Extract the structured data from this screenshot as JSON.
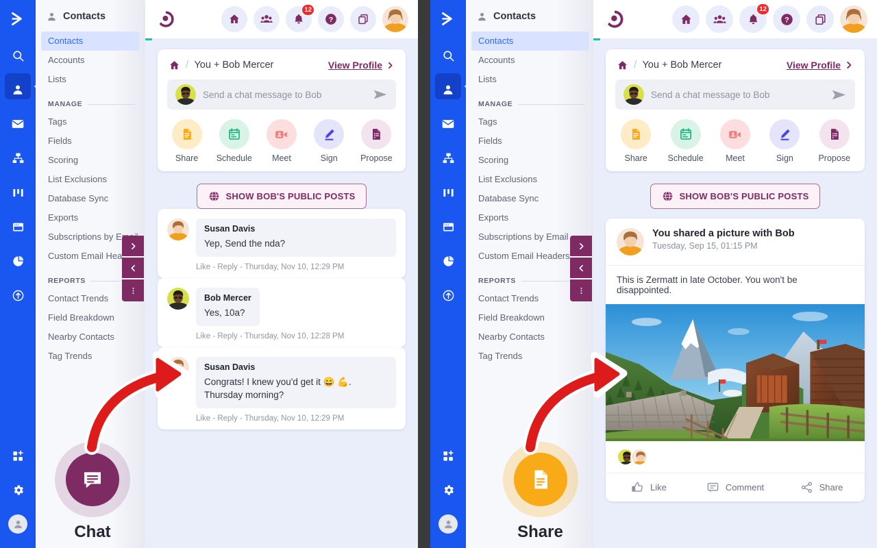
{
  "colors": {
    "rail": "#1a56f0",
    "accent_purple": "#7e2a63",
    "accent_blue": "#2f6bf5",
    "badge_red": "#f0282d",
    "share_yellow": "#f9ab17",
    "chat_purple": "#7e2a63",
    "arrow_red": "#e01b1b"
  },
  "rail": {
    "logo_icon": "chevron-right-logo-icon",
    "items": [
      {
        "icon": "search-icon",
        "name": "search"
      },
      {
        "icon": "person-icon",
        "name": "contacts",
        "active": true
      },
      {
        "icon": "envelope-icon",
        "name": "email"
      },
      {
        "icon": "org-chart-icon",
        "name": "automations"
      },
      {
        "icon": "columns-icon",
        "name": "pipelines"
      },
      {
        "icon": "window-icon",
        "name": "pages"
      },
      {
        "icon": "pie-chart-icon",
        "name": "reports"
      },
      {
        "icon": "arrow-up-circle-icon",
        "name": "upgrade"
      }
    ],
    "bottom": [
      {
        "icon": "apps-add-icon",
        "name": "apps"
      },
      {
        "icon": "gear-icon",
        "name": "settings"
      },
      {
        "icon": "avatar-icon",
        "name": "account"
      }
    ]
  },
  "nav": {
    "title": "Contacts",
    "title_icon": "person-icon",
    "items": [
      {
        "label": "Contacts",
        "selected": true
      },
      {
        "label": "Accounts",
        "selected": false
      },
      {
        "label": "Lists",
        "selected": false
      }
    ],
    "groups": [
      {
        "label": "MANAGE",
        "items": [
          {
            "label": "Tags"
          },
          {
            "label": "Fields"
          },
          {
            "label": "Scoring"
          },
          {
            "label": "List Exclusions"
          },
          {
            "label": "Database Sync"
          },
          {
            "label": "Exports"
          },
          {
            "label": "Subscriptions by Email"
          },
          {
            "label": "Custom Email Headers"
          }
        ]
      },
      {
        "label": "REPORTS",
        "items": [
          {
            "label": "Contact Trends"
          },
          {
            "label": "Field Breakdown"
          },
          {
            "label": "Nearby Contacts"
          },
          {
            "label": "Tag Trends"
          }
        ]
      }
    ]
  },
  "side_tabs": [
    {
      "icon": "chevron-right-icon",
      "name": "expand-panel"
    },
    {
      "icon": "chevron-left-icon",
      "name": "collapse-panel"
    },
    {
      "icon": "more-vertical-icon",
      "name": "panel-options"
    }
  ],
  "header": {
    "logo_icon": "app-logo-icon",
    "icons": [
      {
        "icon": "home-icon",
        "name": "home"
      },
      {
        "icon": "people-icon",
        "name": "people"
      },
      {
        "icon": "bell-icon",
        "name": "notifications",
        "badge": "12"
      },
      {
        "icon": "help-icon",
        "name": "help"
      },
      {
        "icon": "copy-icon",
        "name": "duplicate"
      }
    ],
    "avatar": "user-avatar"
  },
  "contact_card": {
    "home_icon": "home-icon",
    "separator": "/",
    "title": "You + Bob Mercer",
    "view_profile": "View Profile",
    "view_profile_icon": "chevron-right-icon",
    "composer_placeholder": "Send a chat message to Bob",
    "send_icon": "send-icon",
    "quick_actions": [
      {
        "label": "Share",
        "icon": "document-icon",
        "bg": "#fdecc6",
        "fg": "#f9ab17"
      },
      {
        "label": "Schedule",
        "icon": "calendar-icon",
        "bg": "#d9f3e6",
        "fg": "#17b583"
      },
      {
        "label": "Meet",
        "icon": "video-icon",
        "bg": "#fbdedd",
        "fg": "#f07e7c"
      },
      {
        "label": "Sign",
        "icon": "pen-icon",
        "bg": "#e4e4fb",
        "fg": "#4b45e8"
      },
      {
        "label": "Propose",
        "icon": "proposal-icon",
        "bg": "#f3e3ee",
        "fg": "#7e2a63"
      }
    ]
  },
  "show_posts_button": {
    "label": "SHOW BOB'S PUBLIC POSTS",
    "icon": "globe-icon"
  },
  "messages": [
    {
      "author": "Susan Davis",
      "text": "Yep, Send the nda?",
      "avatar": "susan-avatar",
      "like": "Like",
      "reply": "Reply",
      "sep": "-",
      "timestamp": "Thursday, Nov 10, 12:29 PM"
    },
    {
      "author": "Bob Mercer",
      "text": "Yes, 10a?",
      "avatar": "bob-avatar",
      "like": "Like",
      "reply": "Reply",
      "sep": "-",
      "timestamp": "Thursday, Nov 10, 12:28 PM"
    },
    {
      "author": "Susan Davis",
      "text": "Congrats! I knew you'd get it 😄 💪. Thursday morning?",
      "avatar": "susan-avatar",
      "like": "Like",
      "reply": "Reply",
      "sep": "-",
      "timestamp": "Thursday, Nov 10, 12:29 PM"
    }
  ],
  "post": {
    "avatar": "susan-avatar",
    "title": "You shared a picture with Bob",
    "timestamp": "Tuesday,  Sep 15, 01:15 PM",
    "body": "This is Zermatt in late October. You won't be disappointed.",
    "photo_alt": "zermatt-matterhorn-photo",
    "likers": [
      "bob-avatar",
      "susan-avatar"
    ],
    "actions": [
      {
        "label": "Like",
        "icon": "thumbs-up-icon"
      },
      {
        "label": "Comment",
        "icon": "comment-icon"
      },
      {
        "label": "Share",
        "icon": "share-icon"
      }
    ]
  },
  "callouts": {
    "left": {
      "caption": "Chat",
      "icon": "chat-bubble-icon",
      "color": "#7e2a63",
      "halo": "rgba(126,42,99,.16)"
    },
    "right": {
      "caption": "Share",
      "icon": "document-icon",
      "color": "#f9ab17",
      "halo": "rgba(249,171,23,.22)"
    }
  }
}
